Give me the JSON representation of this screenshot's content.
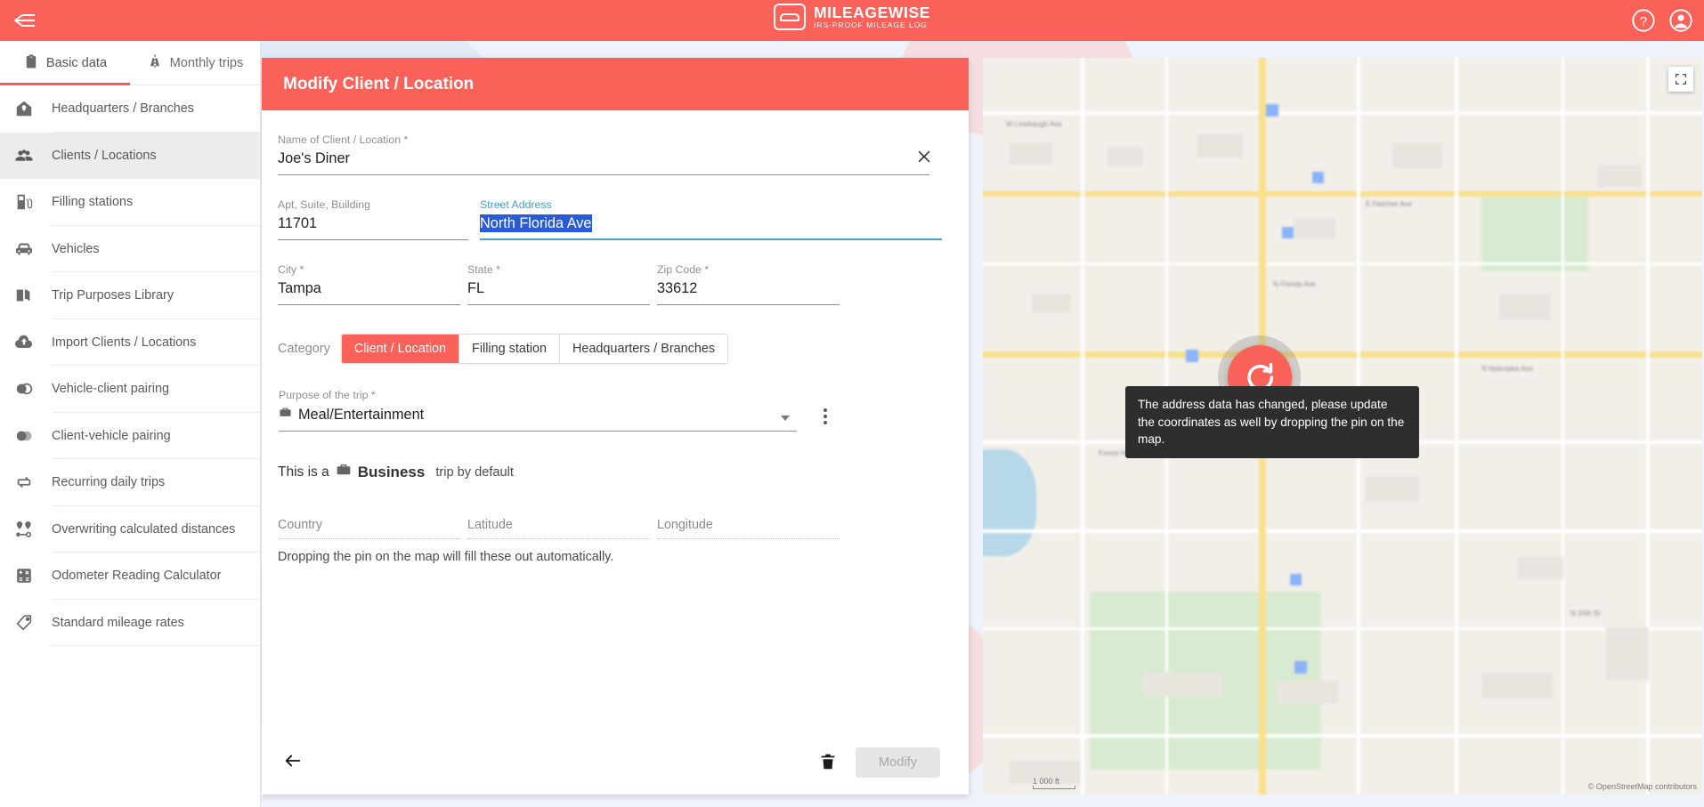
{
  "topbar": {
    "menu_icon": "menu-collapse-icon",
    "brand_title": "MILEAGEWISE",
    "brand_subtitle": "IRS-PROOF MILEAGE LOG",
    "help_icon": "help-circle-icon",
    "account_icon": "account-circle-icon",
    "accent_color": "#fa6158"
  },
  "sidebar": {
    "tabs": [
      {
        "label": "Basic data",
        "icon": "clipboard-icon",
        "active": true
      },
      {
        "label": "Monthly trips",
        "icon": "highway-icon",
        "active": false
      }
    ],
    "items": [
      {
        "label": "Headquarters / Branches",
        "icon": "home-pin-icon",
        "active": false
      },
      {
        "label": "Clients / Locations",
        "icon": "people-group-icon",
        "active": true
      },
      {
        "label": "Filling stations",
        "icon": "fuel-pump-icon",
        "active": false
      },
      {
        "label": "Vehicles",
        "icon": "car-icon",
        "active": false
      },
      {
        "label": "Trip Purposes Library",
        "icon": "book-icon",
        "active": false
      },
      {
        "label": "Import Clients / Locations",
        "icon": "cloud-upload-icon",
        "active": false
      },
      {
        "label": "Vehicle-client pairing",
        "icon": "two-circles-icon",
        "active": false
      },
      {
        "label": "Client-vehicle pairing",
        "icon": "two-circles-icon",
        "active": false
      },
      {
        "label": "Recurring daily trips",
        "icon": "repeat-icon",
        "active": false
      },
      {
        "label": "Overwriting calculated distances",
        "icon": "two-pins-icon",
        "active": false
      },
      {
        "label": "Odometer Reading Calculator",
        "icon": "calculator-icon",
        "active": false
      },
      {
        "label": "Standard mileage rates",
        "icon": "tag-icon",
        "active": false
      }
    ]
  },
  "form": {
    "title": "Modify Client / Location",
    "name": {
      "label": "Name of Client / Location *",
      "value": "Joe's Diner",
      "clear_icon": "close-icon"
    },
    "apt": {
      "label": "Apt, Suite, Building",
      "value": "11701"
    },
    "street": {
      "label": "Street Address",
      "value": "North Florida Ave",
      "focused": true
    },
    "city": {
      "label": "City *",
      "value": "Tampa"
    },
    "state": {
      "label": "State *",
      "value": "FL"
    },
    "zip": {
      "label": "Zip Code *",
      "value": "33612"
    },
    "category": {
      "label": "Category",
      "options": [
        {
          "label": "Client / Location",
          "active": true
        },
        {
          "label": "Filling station",
          "active": false
        },
        {
          "label": "Headquarters / Branches",
          "active": false
        }
      ]
    },
    "purpose": {
      "label": "Purpose of the trip *",
      "value": "Meal/Entertainment",
      "icon": "briefcase-icon",
      "dropdown_icon": "chevron-down-icon",
      "menu_icon": "more-vertical-icon"
    },
    "default_trip": {
      "prefix": "This is a",
      "icon": "briefcase-icon",
      "type": "Business",
      "suffix": "trip by default"
    },
    "geo": {
      "country_label": "Country",
      "latitude_label": "Latitude",
      "longitude_label": "Longitude",
      "hint": "Dropping the pin on the map will fill these out automatically."
    },
    "footer": {
      "back_icon": "arrow-left-icon",
      "delete_icon": "trash-icon",
      "submit_label": "Modify",
      "submit_disabled": true
    }
  },
  "map": {
    "tooltip": "The address data has changed, please update the coordinates as well by dropping the pin on the map.",
    "refresh_icon": "refresh-icon",
    "fullscreen_icon": "fullscreen-icon",
    "attribution": "© OpenStreetMap contributors",
    "scale": "1 000 ft",
    "labels": [
      "W Linebaugh Ave",
      "N Florida Ave",
      "E Fletcher Ave",
      "N Nebraska Ave",
      "Forest Hills",
      "N 15th St"
    ]
  }
}
